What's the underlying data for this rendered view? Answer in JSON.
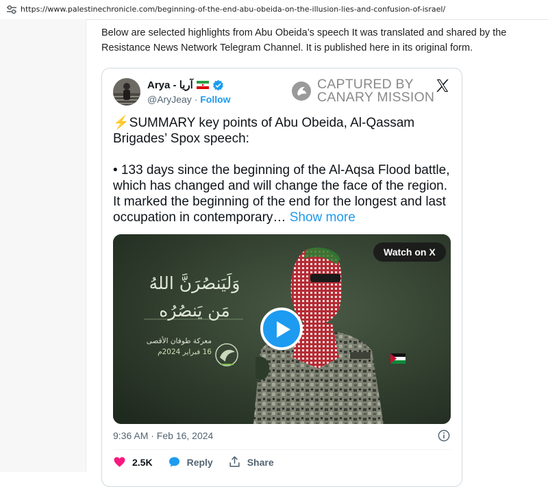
{
  "browser": {
    "url": "https://www.palestinechronicle.com/beginning-of-the-end-abu-obeida-on-the-illusion-lies-and-confusion-of-israel/",
    "site_info_icon": "tune-icon"
  },
  "article": {
    "intro": "Below are selected highlights from Abu Obeida’s speech It was translated and shared by the Resistance News Network Telegram Channel. It is published here in its original form."
  },
  "tweet": {
    "display_name": "Arya - آریا",
    "flag_icon": "iran-flag-icon",
    "verified_icon": "verified-badge-icon",
    "handle": "@AryJeay",
    "separator": " · ",
    "follow_label": "Follow",
    "watermark_line1": "CAPTURED BY",
    "watermark_line2": "CANARY MISSION",
    "platform_icon": "x-logo-icon",
    "summary": "⚡SUMMARY key points of Abu Obeida, Al-Qassam Brigades’ Spox speech:",
    "body": "• 133 days since the beginning of the Al-Aqsa Flood battle, which has changed and will change the face of the region. It marked the beginning of the end for the longest and last occupation in contemporary…",
    "show_more": "Show more",
    "media": {
      "watch_label": "Watch on X",
      "play_icon": "play-icon",
      "arabic_line1": "وَلَيَنصُرَنَّ اللهُ",
      "arabic_line2": "مَن يَنصُرُه",
      "caption_line1": "معركة طوفان الأقصى",
      "caption_line2": "16 فبراير 2024م",
      "colors": {
        "background": "#2f3d2d",
        "play": "#1d9bf0"
      }
    },
    "timestamp": "9:36 AM · Feb 16, 2024",
    "info_icon": "info-icon",
    "likes": "2.5K",
    "reply_label": "Reply",
    "share_label": "Share"
  },
  "colors": {
    "link": "#1d9bf0",
    "like": "#f91880",
    "text": "#0f1419",
    "muted": "#536471"
  }
}
